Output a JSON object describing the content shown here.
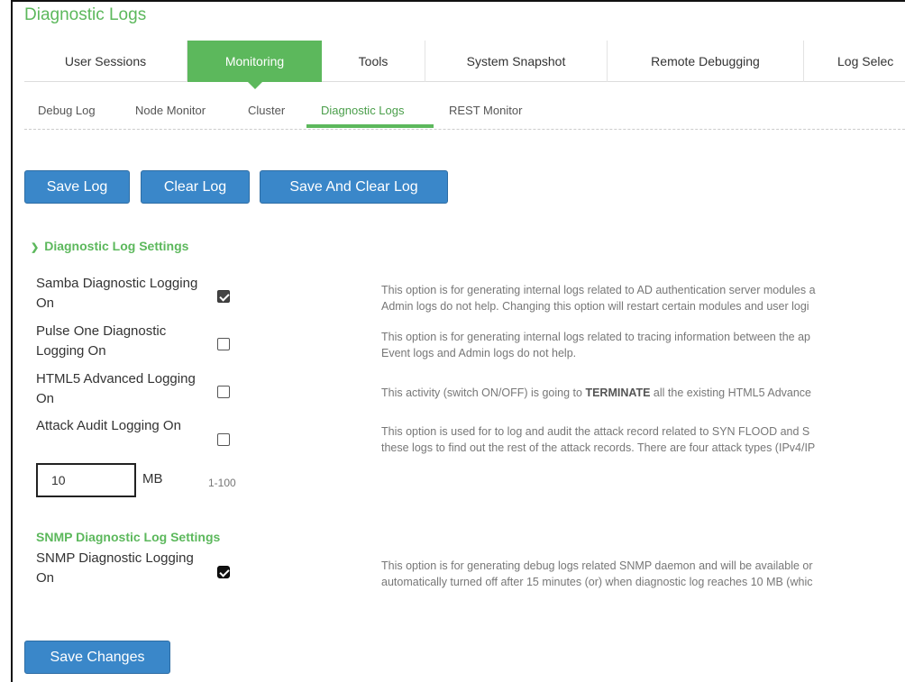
{
  "page_title": "Diagnostic Logs",
  "tabs": [
    {
      "label": "User Sessions"
    },
    {
      "label": "Monitoring",
      "active": true
    },
    {
      "label": "Tools"
    },
    {
      "label": "System Snapshot"
    },
    {
      "label": "Remote Debugging"
    },
    {
      "label": "Log Selec"
    }
  ],
  "subtabs": [
    {
      "label": "Debug Log"
    },
    {
      "label": "Node Monitor"
    },
    {
      "label": "Cluster"
    },
    {
      "label": "Diagnostic Logs",
      "active": true
    },
    {
      "label": "REST Monitor"
    }
  ],
  "actions": {
    "save_log": "Save Log",
    "clear_log": "Clear Log",
    "save_and_clear": "Save And Clear Log"
  },
  "diag_section": {
    "title": "Diagnostic Log Settings",
    "rows": [
      {
        "label": "Samba Diagnostic Logging On",
        "checked": true,
        "desc1": "This option is for generating internal logs related to AD authentication server modules a",
        "desc2": "Admin logs do not help. Changing this option will restart certain modules and user logi"
      },
      {
        "label": "Pulse One Diagnostic Logging On",
        "checked": false,
        "desc1": "This option is for generating internal logs related to tracing information between the ap",
        "desc2": "Event logs and Admin logs do not help."
      },
      {
        "label": "HTML5 Advanced Logging On",
        "checked": false,
        "desc1_pre": "This activity (switch ON/OFF) is going to ",
        "desc1_bold": "TERMINATE",
        "desc1_post": " all the existing HTML5 Advance"
      },
      {
        "label": "Attack Audit Logging On",
        "checked": false,
        "desc1": "This option is used for to log and audit the attack record related to SYN FLOOD and S",
        "desc2": "these logs to find out the rest of the attack records. There are four attack types (IPv4/IP"
      }
    ],
    "size_value": "10",
    "size_unit": "MB",
    "size_range": "1-100"
  },
  "snmp_section": {
    "title": "SNMP Diagnostic Log Settings",
    "label": "SNMP Diagnostic Logging On",
    "checked": true,
    "desc1": "This option is for generating debug logs related SNMP daemon and will be available or",
    "desc2": "automatically turned off after 15 minutes (or) when diagnostic log reaches 10 MB (whic"
  },
  "save_changes": "Save Changes",
  "colors": {
    "accent_green": "#5cb85c",
    "button_blue": "#3a87c9"
  }
}
